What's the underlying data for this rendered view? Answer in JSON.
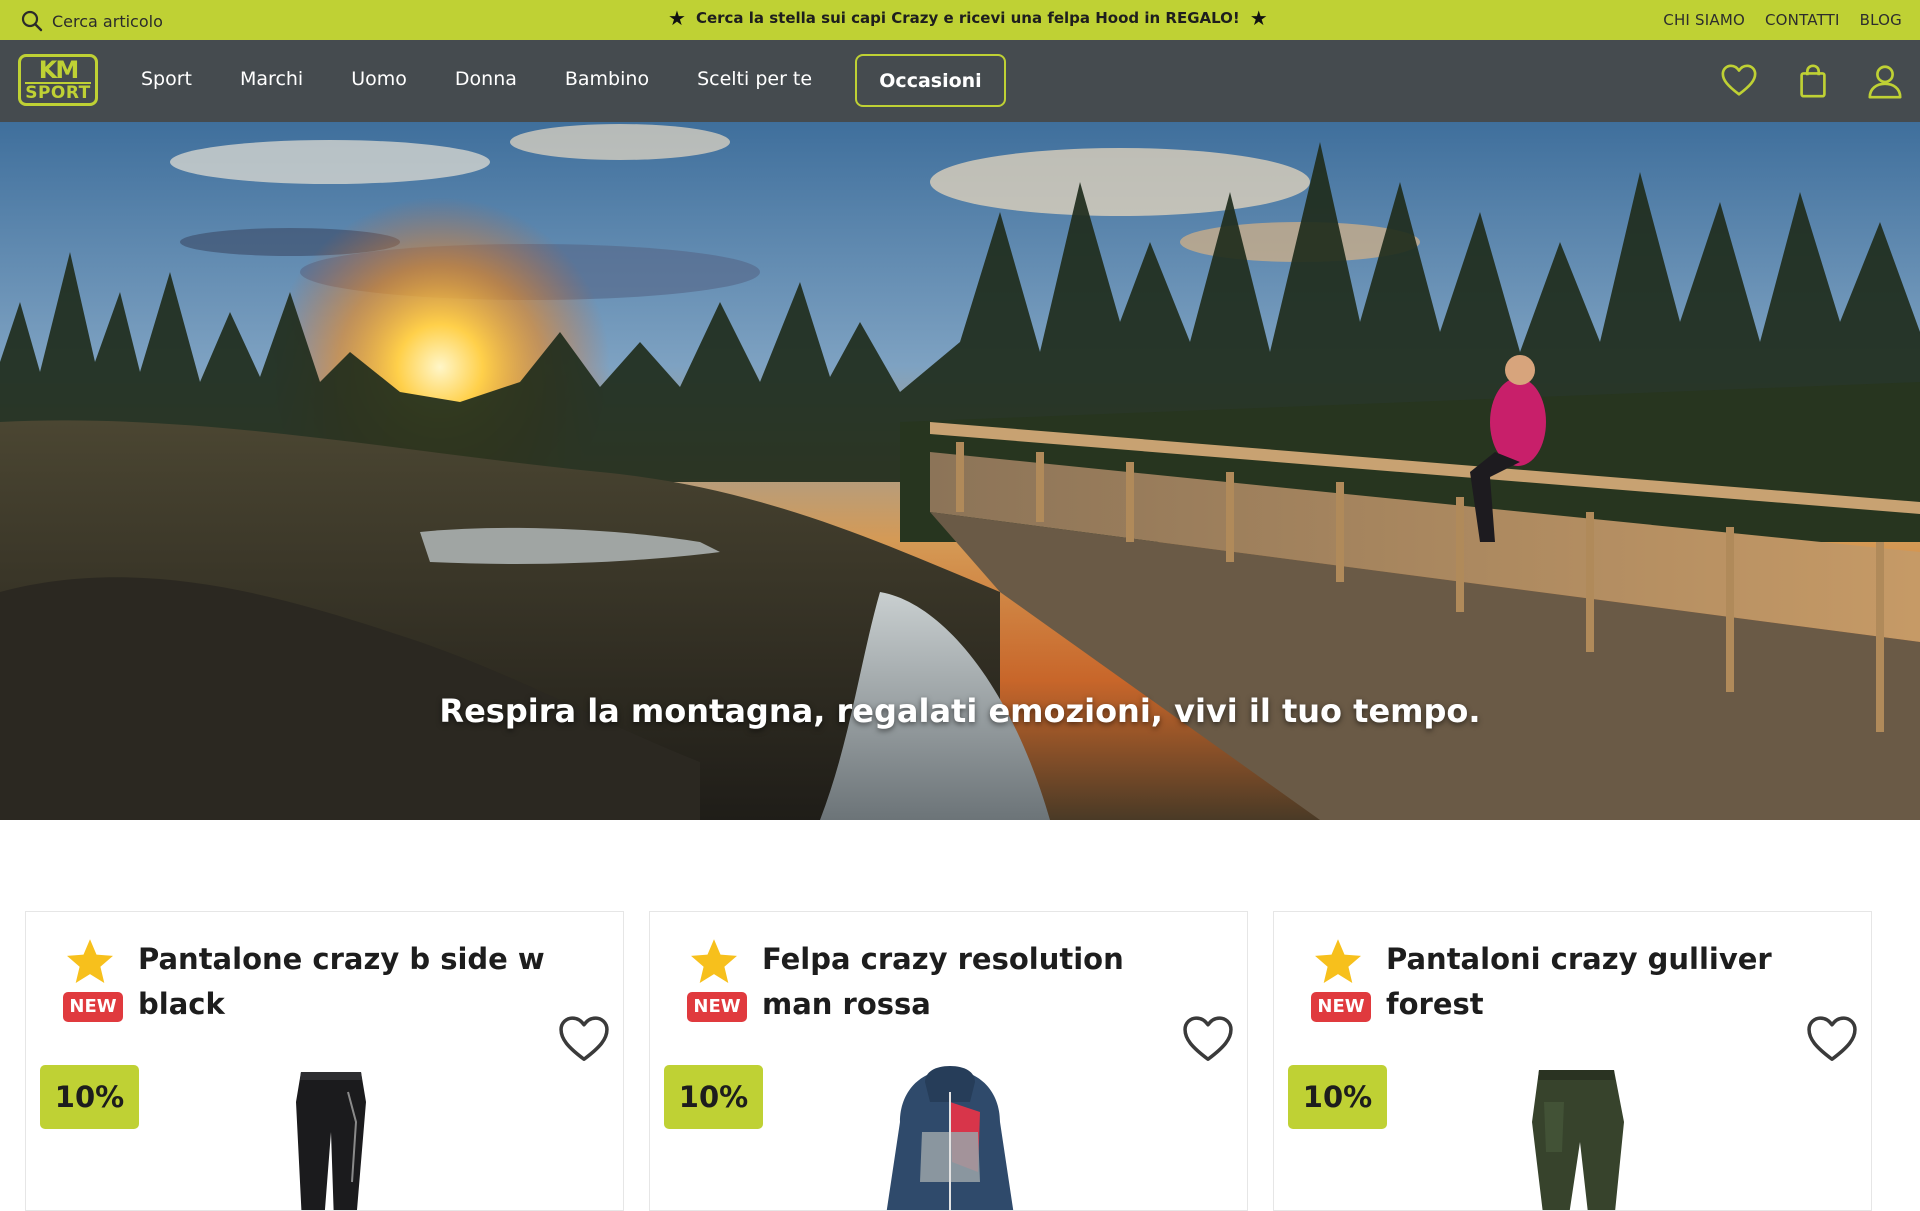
{
  "topbar": {
    "search_placeholder": "Cerca articolo",
    "promo_text": "Cerca la stella sui capi Crazy e ricevi una felpa Hood in REGALO!",
    "links": [
      "CHI SIAMO",
      "CONTATTI",
      "BLOG"
    ]
  },
  "nav": {
    "logo_top": "KM",
    "logo_bottom": "SPORT",
    "menu": [
      "Sport",
      "Marchi",
      "Uomo",
      "Donna",
      "Bambino",
      "Scelti per te"
    ],
    "highlight_button": "Occasioni"
  },
  "hero": {
    "tagline": "Respira la montagna, regalati emozioni, vivi il tuo tempo."
  },
  "products": [
    {
      "title": "Pantalone crazy b side w black",
      "badge": "NEW",
      "discount": "10%",
      "image": "black-pants"
    },
    {
      "title": "Felpa crazy resolution man rossa",
      "badge": "NEW",
      "discount": "10%",
      "image": "blue-red-jacket"
    },
    {
      "title": "Pantaloni crazy gulliver forest",
      "badge": "NEW",
      "discount": "10%",
      "image": "green-pants"
    }
  ],
  "colors": {
    "accent": "#bfd134",
    "nav_bg": "#454b4f",
    "badge_red": "#e03a3e",
    "star_yellow": "#f7c01c"
  }
}
